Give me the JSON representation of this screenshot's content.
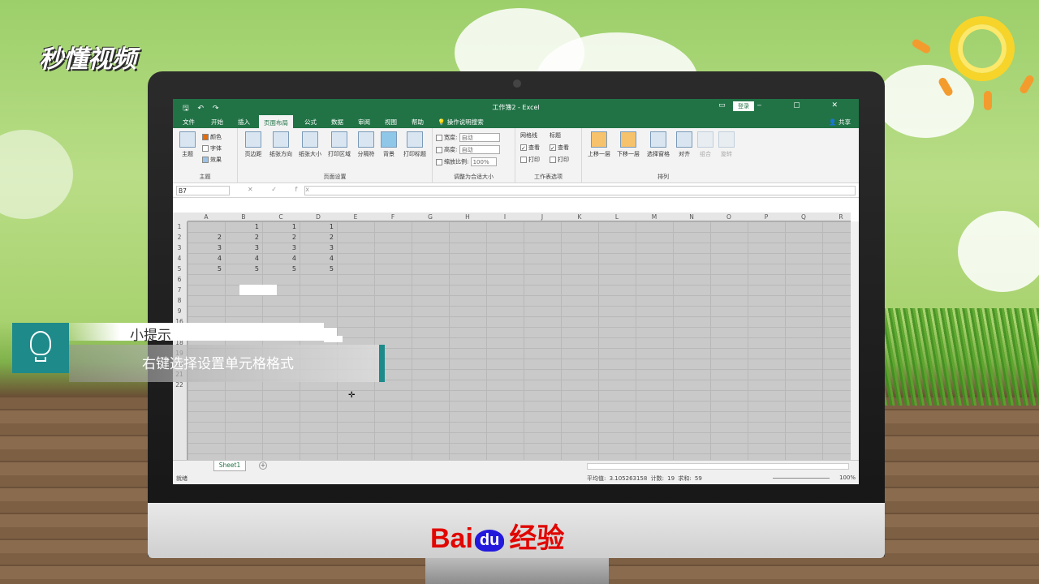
{
  "logo": {
    "text": "秒懂视频"
  },
  "excel": {
    "quick_access": "🖫 ↶ ↷",
    "title": "工作簿2 - Excel",
    "login": "登录",
    "window_controls": "▭ ‒ ▢ ✕",
    "tabs": [
      {
        "label": "文件"
      },
      {
        "label": "开始"
      },
      {
        "label": "插入"
      },
      {
        "label": "页面布局",
        "active": true
      },
      {
        "label": "公式"
      },
      {
        "label": "数据"
      },
      {
        "label": "审阅"
      },
      {
        "label": "视图"
      },
      {
        "label": "帮助"
      },
      {
        "label": "操作说明搜索"
      }
    ],
    "share": "共享",
    "ribbon": {
      "theme_group": {
        "label": "主题",
        "theme": "主题",
        "colors": "颜色",
        "fonts": "字体",
        "effects": "效果"
      },
      "page_setup_group": {
        "label": "页面设置",
        "buttons": [
          "页边距",
          "纸张方向",
          "纸张大小",
          "打印区域",
          "分隔符",
          "背景",
          "打印标题"
        ]
      },
      "scale_group": {
        "label": "调整为合适大小",
        "width_label": "宽度:",
        "width_value": "自动",
        "height_label": "高度:",
        "height_value": "自动",
        "scale_label": "缩放比例:",
        "scale_value": "100%"
      },
      "sheet_options_group": {
        "label": "工作表选项",
        "gridlines": "网格线",
        "headings": "标题",
        "view": "查看",
        "print": "打印"
      },
      "arrange_group": {
        "label": "排列",
        "buttons": [
          "上移一层",
          "下移一层",
          "选择窗格",
          "对齐",
          "组合",
          "旋转"
        ]
      }
    },
    "name_box": "B7",
    "formula_icons": "✕ ✓ fx",
    "columns": [
      "A",
      "B",
      "C",
      "D",
      "E",
      "F",
      "G",
      "H",
      "I",
      "J",
      "K",
      "L",
      "M",
      "N",
      "O",
      "P",
      "Q",
      "R"
    ],
    "rows": [
      "1",
      "2",
      "3",
      "4",
      "5",
      "6",
      "7",
      "8",
      "9",
      "16",
      "17",
      "18",
      "19",
      "20",
      "21",
      "22"
    ],
    "cells": [
      {
        "col": 1,
        "row": 0,
        "value": "1"
      },
      {
        "col": 2,
        "row": 0,
        "value": "1"
      },
      {
        "col": 3,
        "row": 0,
        "value": "1"
      },
      {
        "col": 0,
        "row": 1,
        "value": "2"
      },
      {
        "col": 1,
        "row": 1,
        "value": "2"
      },
      {
        "col": 2,
        "row": 1,
        "value": "2"
      },
      {
        "col": 3,
        "row": 1,
        "value": "2"
      },
      {
        "col": 0,
        "row": 2,
        "value": "3"
      },
      {
        "col": 1,
        "row": 2,
        "value": "3"
      },
      {
        "col": 2,
        "row": 2,
        "value": "3"
      },
      {
        "col": 3,
        "row": 2,
        "value": "3"
      },
      {
        "col": 0,
        "row": 3,
        "value": "4"
      },
      {
        "col": 1,
        "row": 3,
        "value": "4"
      },
      {
        "col": 2,
        "row": 3,
        "value": "4"
      },
      {
        "col": 3,
        "row": 3,
        "value": "4"
      },
      {
        "col": 0,
        "row": 4,
        "value": "5"
      },
      {
        "col": 1,
        "row": 4,
        "value": "5"
      },
      {
        "col": 2,
        "row": 4,
        "value": "5"
      },
      {
        "col": 3,
        "row": 4,
        "value": "5"
      }
    ],
    "sheet_tab": "Sheet1",
    "status": {
      "ready": "就绪",
      "stats": "平均值: 3.105263158   计数: 19   求和: 59",
      "zoom": "100%"
    }
  },
  "tip": {
    "heading": "小提示",
    "body": "右键选择设置单元格格式"
  },
  "brand": {
    "name": "Bai",
    "paw": "du",
    "suffix": "经验"
  }
}
